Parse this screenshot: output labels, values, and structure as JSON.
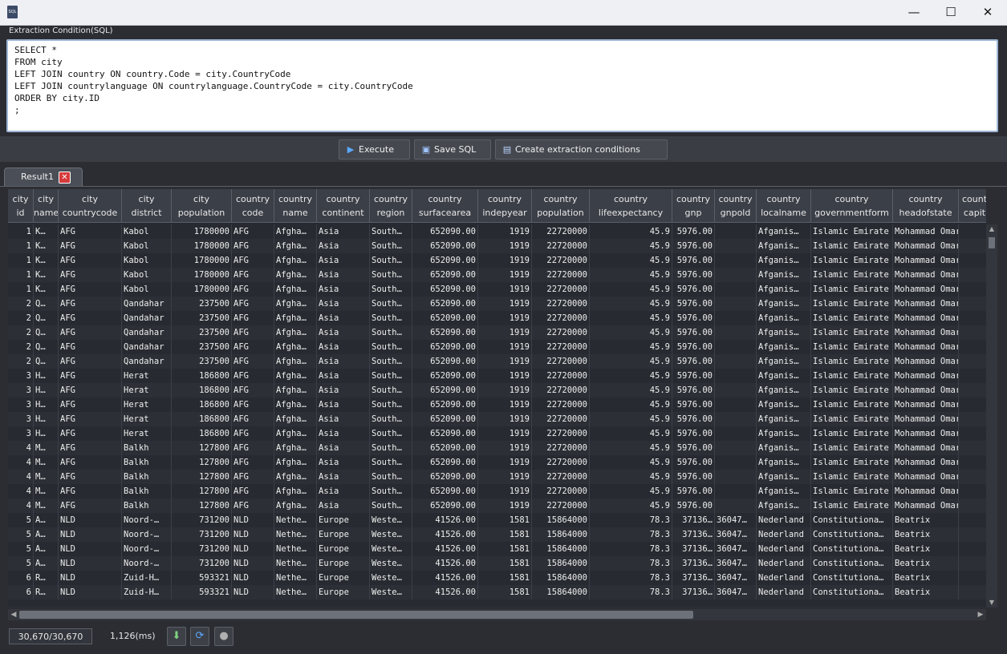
{
  "window": {
    "icon": "sql-file-icon",
    "min": "—",
    "max": "☐",
    "close": "✕"
  },
  "sql": {
    "label": "Extraction Condition(SQL)",
    "text": "SELECT *\nFROM city\nLEFT JOIN country ON country.Code = city.CountryCode\nLEFT JOIN countrylanguage ON countrylanguage.CountryCode = city.CountryCode\nORDER BY city.ID\n;"
  },
  "toolbar": {
    "execute": "Execute",
    "save": "Save SQL",
    "create": "Create extraction conditions"
  },
  "tabs": [
    {
      "label": "Result1"
    }
  ],
  "columns": [
    {
      "l1": "city",
      "l2": "id"
    },
    {
      "l1": "city",
      "l2": "name"
    },
    {
      "l1": "city",
      "l2": "countrycode"
    },
    {
      "l1": "city",
      "l2": "district"
    },
    {
      "l1": "city",
      "l2": "population"
    },
    {
      "l1": "country",
      "l2": "code"
    },
    {
      "l1": "country",
      "l2": "name"
    },
    {
      "l1": "country",
      "l2": "continent"
    },
    {
      "l1": "country",
      "l2": "region"
    },
    {
      "l1": "country",
      "l2": "surfacearea"
    },
    {
      "l1": "country",
      "l2": "indepyear"
    },
    {
      "l1": "country",
      "l2": "population"
    },
    {
      "l1": "country",
      "l2": "lifeexpectancy"
    },
    {
      "l1": "country",
      "l2": "gnp"
    },
    {
      "l1": "country",
      "l2": "gnpold"
    },
    {
      "l1": "country",
      "l2": "localname"
    },
    {
      "l1": "country",
      "l2": "governmentform"
    },
    {
      "l1": "country",
      "l2": "headofstate"
    },
    {
      "l1": "count",
      "l2": "capit"
    }
  ],
  "rows": [
    [
      "1",
      "K…",
      "AFG",
      "Kabol",
      "1780000",
      "AFG",
      "Afgha…",
      "Asia",
      "South…",
      "652090.00",
      "1919",
      "22720000",
      "45.9",
      "5976.00",
      "",
      "Afganis…",
      "Islamic Emirate",
      "Mohammad Omar",
      ""
    ],
    [
      "1",
      "K…",
      "AFG",
      "Kabol",
      "1780000",
      "AFG",
      "Afgha…",
      "Asia",
      "South…",
      "652090.00",
      "1919",
      "22720000",
      "45.9",
      "5976.00",
      "",
      "Afganis…",
      "Islamic Emirate",
      "Mohammad Omar",
      ""
    ],
    [
      "1",
      "K…",
      "AFG",
      "Kabol",
      "1780000",
      "AFG",
      "Afgha…",
      "Asia",
      "South…",
      "652090.00",
      "1919",
      "22720000",
      "45.9",
      "5976.00",
      "",
      "Afganis…",
      "Islamic Emirate",
      "Mohammad Omar",
      ""
    ],
    [
      "1",
      "K…",
      "AFG",
      "Kabol",
      "1780000",
      "AFG",
      "Afgha…",
      "Asia",
      "South…",
      "652090.00",
      "1919",
      "22720000",
      "45.9",
      "5976.00",
      "",
      "Afganis…",
      "Islamic Emirate",
      "Mohammad Omar",
      ""
    ],
    [
      "1",
      "K…",
      "AFG",
      "Kabol",
      "1780000",
      "AFG",
      "Afgha…",
      "Asia",
      "South…",
      "652090.00",
      "1919",
      "22720000",
      "45.9",
      "5976.00",
      "",
      "Afganis…",
      "Islamic Emirate",
      "Mohammad Omar",
      ""
    ],
    [
      "2",
      "Q…",
      "AFG",
      "Qandahar",
      "237500",
      "AFG",
      "Afgha…",
      "Asia",
      "South…",
      "652090.00",
      "1919",
      "22720000",
      "45.9",
      "5976.00",
      "",
      "Afganis…",
      "Islamic Emirate",
      "Mohammad Omar",
      ""
    ],
    [
      "2",
      "Q…",
      "AFG",
      "Qandahar",
      "237500",
      "AFG",
      "Afgha…",
      "Asia",
      "South…",
      "652090.00",
      "1919",
      "22720000",
      "45.9",
      "5976.00",
      "",
      "Afganis…",
      "Islamic Emirate",
      "Mohammad Omar",
      ""
    ],
    [
      "2",
      "Q…",
      "AFG",
      "Qandahar",
      "237500",
      "AFG",
      "Afgha…",
      "Asia",
      "South…",
      "652090.00",
      "1919",
      "22720000",
      "45.9",
      "5976.00",
      "",
      "Afganis…",
      "Islamic Emirate",
      "Mohammad Omar",
      ""
    ],
    [
      "2",
      "Q…",
      "AFG",
      "Qandahar",
      "237500",
      "AFG",
      "Afgha…",
      "Asia",
      "South…",
      "652090.00",
      "1919",
      "22720000",
      "45.9",
      "5976.00",
      "",
      "Afganis…",
      "Islamic Emirate",
      "Mohammad Omar",
      ""
    ],
    [
      "2",
      "Q…",
      "AFG",
      "Qandahar",
      "237500",
      "AFG",
      "Afgha…",
      "Asia",
      "South…",
      "652090.00",
      "1919",
      "22720000",
      "45.9",
      "5976.00",
      "",
      "Afganis…",
      "Islamic Emirate",
      "Mohammad Omar",
      ""
    ],
    [
      "3",
      "H…",
      "AFG",
      "Herat",
      "186800",
      "AFG",
      "Afgha…",
      "Asia",
      "South…",
      "652090.00",
      "1919",
      "22720000",
      "45.9",
      "5976.00",
      "",
      "Afganis…",
      "Islamic Emirate",
      "Mohammad Omar",
      ""
    ],
    [
      "3",
      "H…",
      "AFG",
      "Herat",
      "186800",
      "AFG",
      "Afgha…",
      "Asia",
      "South…",
      "652090.00",
      "1919",
      "22720000",
      "45.9",
      "5976.00",
      "",
      "Afganis…",
      "Islamic Emirate",
      "Mohammad Omar",
      ""
    ],
    [
      "3",
      "H…",
      "AFG",
      "Herat",
      "186800",
      "AFG",
      "Afgha…",
      "Asia",
      "South…",
      "652090.00",
      "1919",
      "22720000",
      "45.9",
      "5976.00",
      "",
      "Afganis…",
      "Islamic Emirate",
      "Mohammad Omar",
      ""
    ],
    [
      "3",
      "H…",
      "AFG",
      "Herat",
      "186800",
      "AFG",
      "Afgha…",
      "Asia",
      "South…",
      "652090.00",
      "1919",
      "22720000",
      "45.9",
      "5976.00",
      "",
      "Afganis…",
      "Islamic Emirate",
      "Mohammad Omar",
      ""
    ],
    [
      "3",
      "H…",
      "AFG",
      "Herat",
      "186800",
      "AFG",
      "Afgha…",
      "Asia",
      "South…",
      "652090.00",
      "1919",
      "22720000",
      "45.9",
      "5976.00",
      "",
      "Afganis…",
      "Islamic Emirate",
      "Mohammad Omar",
      ""
    ],
    [
      "4",
      "M…",
      "AFG",
      "Balkh",
      "127800",
      "AFG",
      "Afgha…",
      "Asia",
      "South…",
      "652090.00",
      "1919",
      "22720000",
      "45.9",
      "5976.00",
      "",
      "Afganis…",
      "Islamic Emirate",
      "Mohammad Omar",
      ""
    ],
    [
      "4",
      "M…",
      "AFG",
      "Balkh",
      "127800",
      "AFG",
      "Afgha…",
      "Asia",
      "South…",
      "652090.00",
      "1919",
      "22720000",
      "45.9",
      "5976.00",
      "",
      "Afganis…",
      "Islamic Emirate",
      "Mohammad Omar",
      ""
    ],
    [
      "4",
      "M…",
      "AFG",
      "Balkh",
      "127800",
      "AFG",
      "Afgha…",
      "Asia",
      "South…",
      "652090.00",
      "1919",
      "22720000",
      "45.9",
      "5976.00",
      "",
      "Afganis…",
      "Islamic Emirate",
      "Mohammad Omar",
      ""
    ],
    [
      "4",
      "M…",
      "AFG",
      "Balkh",
      "127800",
      "AFG",
      "Afgha…",
      "Asia",
      "South…",
      "652090.00",
      "1919",
      "22720000",
      "45.9",
      "5976.00",
      "",
      "Afganis…",
      "Islamic Emirate",
      "Mohammad Omar",
      ""
    ],
    [
      "4",
      "M…",
      "AFG",
      "Balkh",
      "127800",
      "AFG",
      "Afgha…",
      "Asia",
      "South…",
      "652090.00",
      "1919",
      "22720000",
      "45.9",
      "5976.00",
      "",
      "Afganis…",
      "Islamic Emirate",
      "Mohammad Omar",
      ""
    ],
    [
      "5",
      "A…",
      "NLD",
      "Noord-…",
      "731200",
      "NLD",
      "Nethe…",
      "Europe",
      "Weste…",
      "41526.00",
      "1581",
      "15864000",
      "78.3",
      "37136…",
      "36047…",
      "Nederland",
      "Constitutiona…",
      "Beatrix",
      ""
    ],
    [
      "5",
      "A…",
      "NLD",
      "Noord-…",
      "731200",
      "NLD",
      "Nethe…",
      "Europe",
      "Weste…",
      "41526.00",
      "1581",
      "15864000",
      "78.3",
      "37136…",
      "36047…",
      "Nederland",
      "Constitutiona…",
      "Beatrix",
      ""
    ],
    [
      "5",
      "A…",
      "NLD",
      "Noord-…",
      "731200",
      "NLD",
      "Nethe…",
      "Europe",
      "Weste…",
      "41526.00",
      "1581",
      "15864000",
      "78.3",
      "37136…",
      "36047…",
      "Nederland",
      "Constitutiona…",
      "Beatrix",
      ""
    ],
    [
      "5",
      "A…",
      "NLD",
      "Noord-…",
      "731200",
      "NLD",
      "Nethe…",
      "Europe",
      "Weste…",
      "41526.00",
      "1581",
      "15864000",
      "78.3",
      "37136…",
      "36047…",
      "Nederland",
      "Constitutiona…",
      "Beatrix",
      ""
    ],
    [
      "6",
      "R…",
      "NLD",
      "Zuid-H…",
      "593321",
      "NLD",
      "Nethe…",
      "Europe",
      "Weste…",
      "41526.00",
      "1581",
      "15864000",
      "78.3",
      "37136…",
      "36047…",
      "Nederland",
      "Constitutiona…",
      "Beatrix",
      ""
    ],
    [
      "6",
      "R…",
      "NLD",
      "Zuid-H…",
      "593321",
      "NLD",
      "Nethe…",
      "Europe",
      "Weste…",
      "41526.00",
      "1581",
      "15864000",
      "78.3",
      "37136…",
      "36047…",
      "Nederland",
      "Constitutiona…",
      "Beatrix",
      ""
    ]
  ],
  "status": {
    "count": "30,670/30,670",
    "time": "1,126(ms)"
  },
  "icons": {
    "execute": "play-icon",
    "save": "floppy-disk-icon",
    "create": "document-icon",
    "export": "export-icon",
    "refresh": "refresh-icon",
    "stop": "stop-icon"
  }
}
